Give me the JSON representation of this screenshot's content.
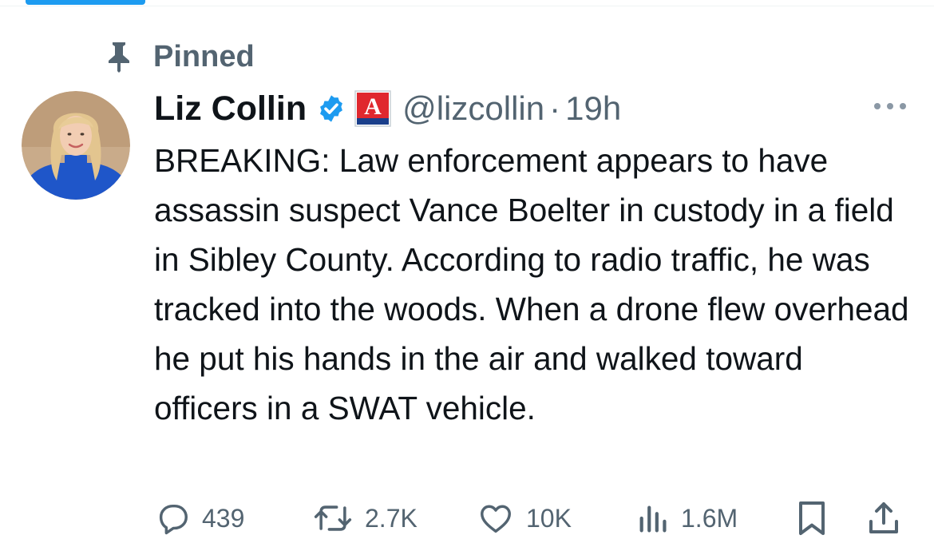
{
  "pinned": {
    "label": "Pinned",
    "icon": "pin-icon"
  },
  "author": {
    "name": "Liz Collin",
    "handle": "@lizcollin",
    "separator": "·",
    "time": "19h",
    "verified_icon": "verified-badge-icon",
    "affiliate_icon": "affiliate-logo-icon",
    "affiliate_letter": "A"
  },
  "tweet": {
    "text": "BREAKING: Law enforcement appears to have assassin suspect Vance Boelter in custody in a field in Sibley County. According to radio traffic, he was tracked into the woods. When a drone flew overhead he put his hands in the air and walked toward officers in a SWAT vehicle."
  },
  "actions": {
    "replies": "439",
    "reposts": "2.7K",
    "likes": "10K",
    "views": "1.6M"
  },
  "colors": {
    "accent": "#1d9bf0",
    "muted_text": "#536471",
    "main_text": "#0f1419",
    "affiliate_red": "#e0282e"
  }
}
